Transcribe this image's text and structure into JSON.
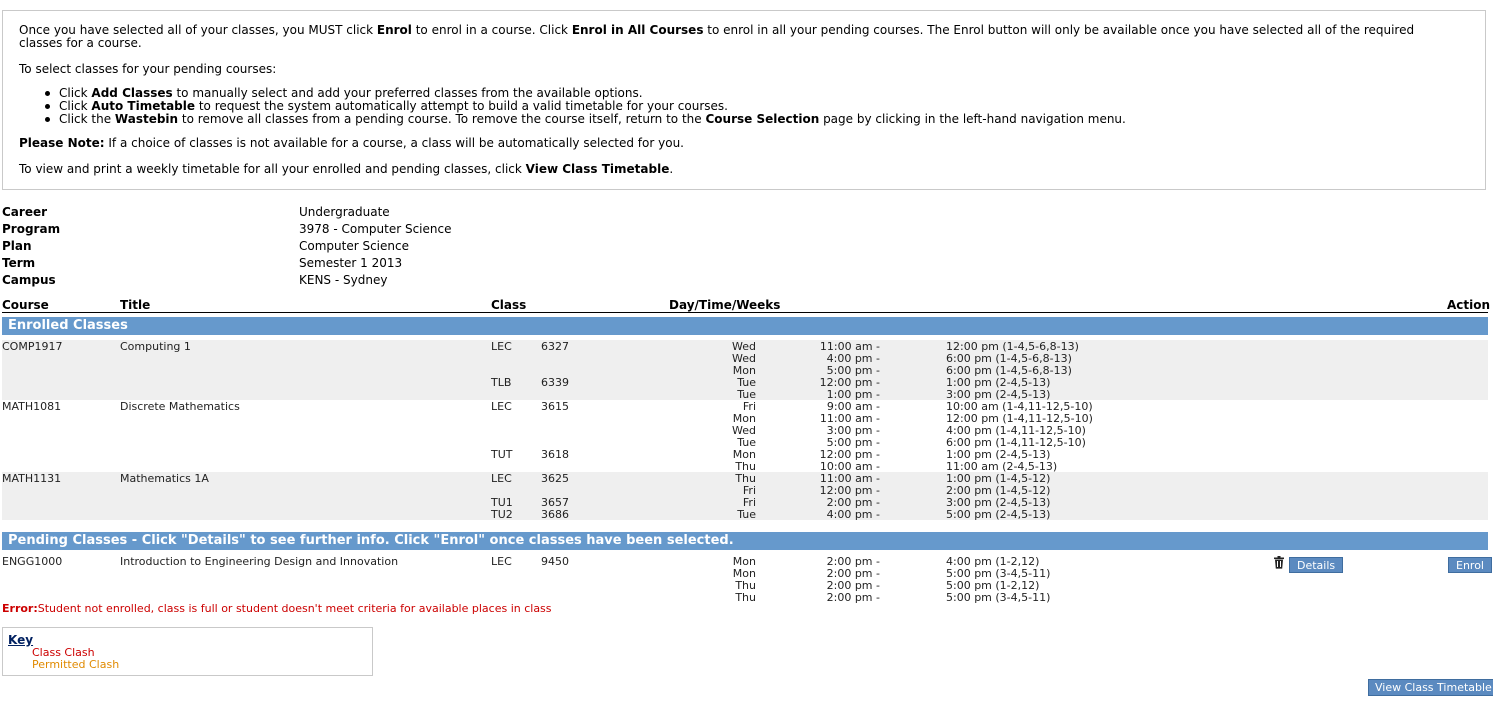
{
  "info": {
    "para1_pre": "Once you have selected all of your classes, you MUST click ",
    "para1_enrol": "Enrol",
    "para1_mid": " to enrol in a course. Click ",
    "para1_all": "Enrol in All Courses",
    "para1_post": " to enrol in all your pending courses. The Enrol button will only be available once you have selected all of the required classes for a course.",
    "para2": "To select classes for your pending courses:",
    "bullets": [
      {
        "pre": "Click ",
        "bold": "Add Classes",
        "post": " to manually select and add your preferred classes from the available options."
      },
      {
        "pre": "Click ",
        "bold": "Auto Timetable",
        "post": " to request the system automatically attempt to build a valid timetable for your courses."
      },
      {
        "pre": "Click the ",
        "bold": "Wastebin",
        "post": " to remove all classes from a pending course. To remove the course itself, return to the ",
        "bold2": "Course Selection",
        "post2": " page by clicking in the left-hand navigation menu."
      }
    ],
    "note_label": "Please Note:",
    "note_text": " If a choice of classes is not available for a course, a class will be automatically selected for you.",
    "view_pre": "To view and print a weekly timetable for all your enrolled and pending classes, click ",
    "view_bold": "View Class Timetable",
    "view_post": "."
  },
  "details": [
    {
      "label": "Career",
      "value": "Undergraduate"
    },
    {
      "label": "Program",
      "value": "3978 - Computer Science"
    },
    {
      "label": "Plan",
      "value": "Computer Science"
    },
    {
      "label": "Term",
      "value": "Semester 1 2013"
    },
    {
      "label": "Campus",
      "value": "KENS - Sydney"
    }
  ],
  "columns": {
    "course": "Course",
    "title": "Title",
    "class": "Class",
    "daytime": "Day/Time/Weeks",
    "action": "Action"
  },
  "enrolled_band": "Enrolled Classes",
  "enrolled": [
    {
      "course": "COMP1917",
      "title": "Computing 1",
      "shade": true,
      "rows": [
        {
          "type": "LEC",
          "num": "6327",
          "day": "Wed",
          "start": "11:00 am -",
          "end": "12:00 pm (1-4,5-6,8-13)"
        },
        {
          "type": "",
          "num": "",
          "day": "Wed",
          "start": "4:00 pm -",
          "end": "6:00 pm (1-4,5-6,8-13)"
        },
        {
          "type": "",
          "num": "",
          "day": "Mon",
          "start": "5:00 pm -",
          "end": "6:00 pm (1-4,5-6,8-13)"
        },
        {
          "type": "TLB",
          "num": "6339",
          "day": "Tue",
          "start": "12:00 pm -",
          "end": "1:00 pm (2-4,5-13)"
        },
        {
          "type": "",
          "num": "",
          "day": "Tue",
          "start": "1:00 pm -",
          "end": "3:00 pm (2-4,5-13)"
        }
      ]
    },
    {
      "course": "MATH1081",
      "title": "Discrete Mathematics",
      "shade": false,
      "rows": [
        {
          "type": "LEC",
          "num": "3615",
          "day": "Fri",
          "start": "9:00 am -",
          "end": "10:00 am (1-4,11-12,5-10)"
        },
        {
          "type": "",
          "num": "",
          "day": "Mon",
          "start": "11:00 am -",
          "end": "12:00 pm (1-4,11-12,5-10)"
        },
        {
          "type": "",
          "num": "",
          "day": "Wed",
          "start": "3:00 pm -",
          "end": "4:00 pm (1-4,11-12,5-10)"
        },
        {
          "type": "",
          "num": "",
          "day": "Tue",
          "start": "5:00 pm -",
          "end": "6:00 pm (1-4,11-12,5-10)"
        },
        {
          "type": "TUT",
          "num": "3618",
          "day": "Mon",
          "start": "12:00 pm -",
          "end": "1:00 pm (2-4,5-13)"
        },
        {
          "type": "",
          "num": "",
          "day": "Thu",
          "start": "10:00 am -",
          "end": "11:00 am (2-4,5-13)"
        }
      ]
    },
    {
      "course": "MATH1131",
      "title": "Mathematics 1A",
      "shade": true,
      "rows": [
        {
          "type": "LEC",
          "num": "3625",
          "day": "Thu",
          "start": "11:00 am -",
          "end": "1:00 pm (1-4,5-12)"
        },
        {
          "type": "",
          "num": "",
          "day": "Fri",
          "start": "12:00 pm -",
          "end": "2:00 pm (1-4,5-12)"
        },
        {
          "type": "TU1",
          "num": "3657",
          "day": "Fri",
          "start": "2:00 pm -",
          "end": "3:00 pm (2-4,5-13)"
        },
        {
          "type": "TU2",
          "num": "3686",
          "day": "Tue",
          "start": "4:00 pm -",
          "end": "5:00 pm (2-4,5-13)"
        }
      ]
    }
  ],
  "pending_band": "Pending Classes - Click \"Details\" to see further info. Click \"Enrol\" once classes have been selected.",
  "pending": [
    {
      "course": "ENGG1000",
      "title": "Introduction to Engineering Design and Innovation",
      "shade": false,
      "rows": [
        {
          "type": "LEC",
          "num": "9450",
          "day": "Mon",
          "start": "2:00 pm -",
          "end": "4:00 pm (1-2,12)"
        },
        {
          "type": "",
          "num": "",
          "day": "Mon",
          "start": "2:00 pm -",
          "end": "5:00 pm (3-4,5-11)"
        },
        {
          "type": "",
          "num": "",
          "day": "Thu",
          "start": "2:00 pm -",
          "end": "5:00 pm (1-2,12)"
        },
        {
          "type": "",
          "num": "",
          "day": "Thu",
          "start": "2:00 pm -",
          "end": "5:00 pm (3-4,5-11)"
        }
      ]
    }
  ],
  "buttons": {
    "details": "Details",
    "enrol": "Enrol",
    "view_timetable": "View Class Timetable"
  },
  "error": {
    "label": "Error:",
    "text": "Student not enrolled, class is full or student doesn't meet criteria for available places in class"
  },
  "key": {
    "title": "Key",
    "class_clash": "Class Clash",
    "permitted_clash": "Permitted Clash"
  },
  "colors": {
    "band": "#6699cc",
    "error": "#cc0000",
    "permitted": "#e08a00",
    "button": "#5b8ac0"
  }
}
